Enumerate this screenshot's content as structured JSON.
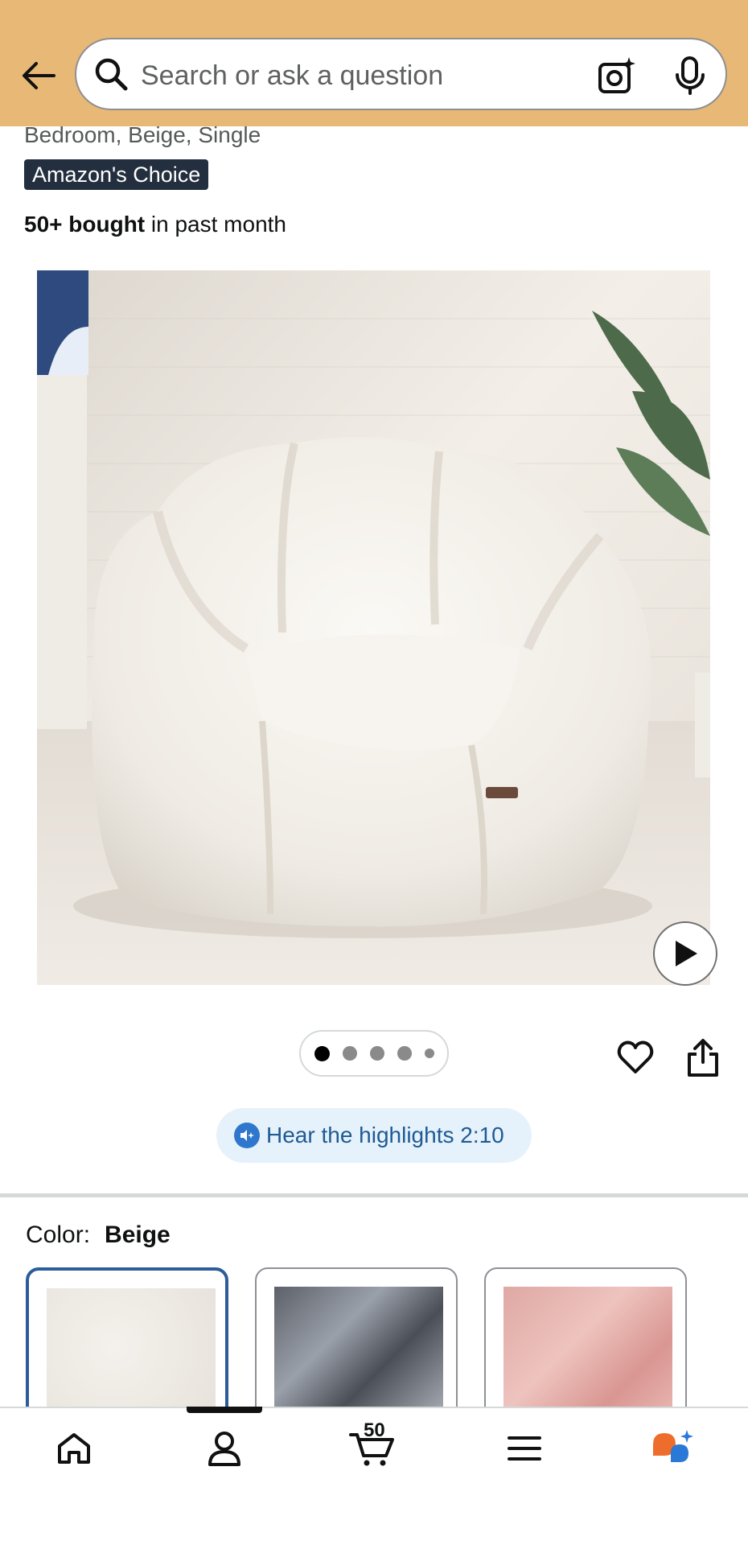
{
  "search": {
    "placeholder": "Search or ask a question"
  },
  "product": {
    "subtitle": "Bedroom, Beige, Single",
    "badge": "Amazon's Choice",
    "bought_strong": "50+ bought",
    "bought_rest": " in past month",
    "image_dots": 5,
    "active_dot": 1
  },
  "highlights": {
    "label": "Hear the highlights 2:10"
  },
  "color": {
    "label": "Color:",
    "value": "Beige",
    "swatches": [
      {
        "name": "Beige",
        "selected": true
      },
      {
        "name": "Grey",
        "selected": false
      },
      {
        "name": "Pink",
        "selected": false
      }
    ]
  },
  "nav": {
    "items": [
      "home-icon",
      "account-icon",
      "cart-icon",
      "menu-icon",
      "rufus-icon"
    ],
    "active_index": 1,
    "cart_count": "50"
  },
  "colors": {
    "header": "#e8b877",
    "badge": "#232f3e",
    "highlight_bg": "#e6f2fb",
    "highlight_text": "#1e5a93",
    "swatch_selected": "#2c5d9a"
  }
}
